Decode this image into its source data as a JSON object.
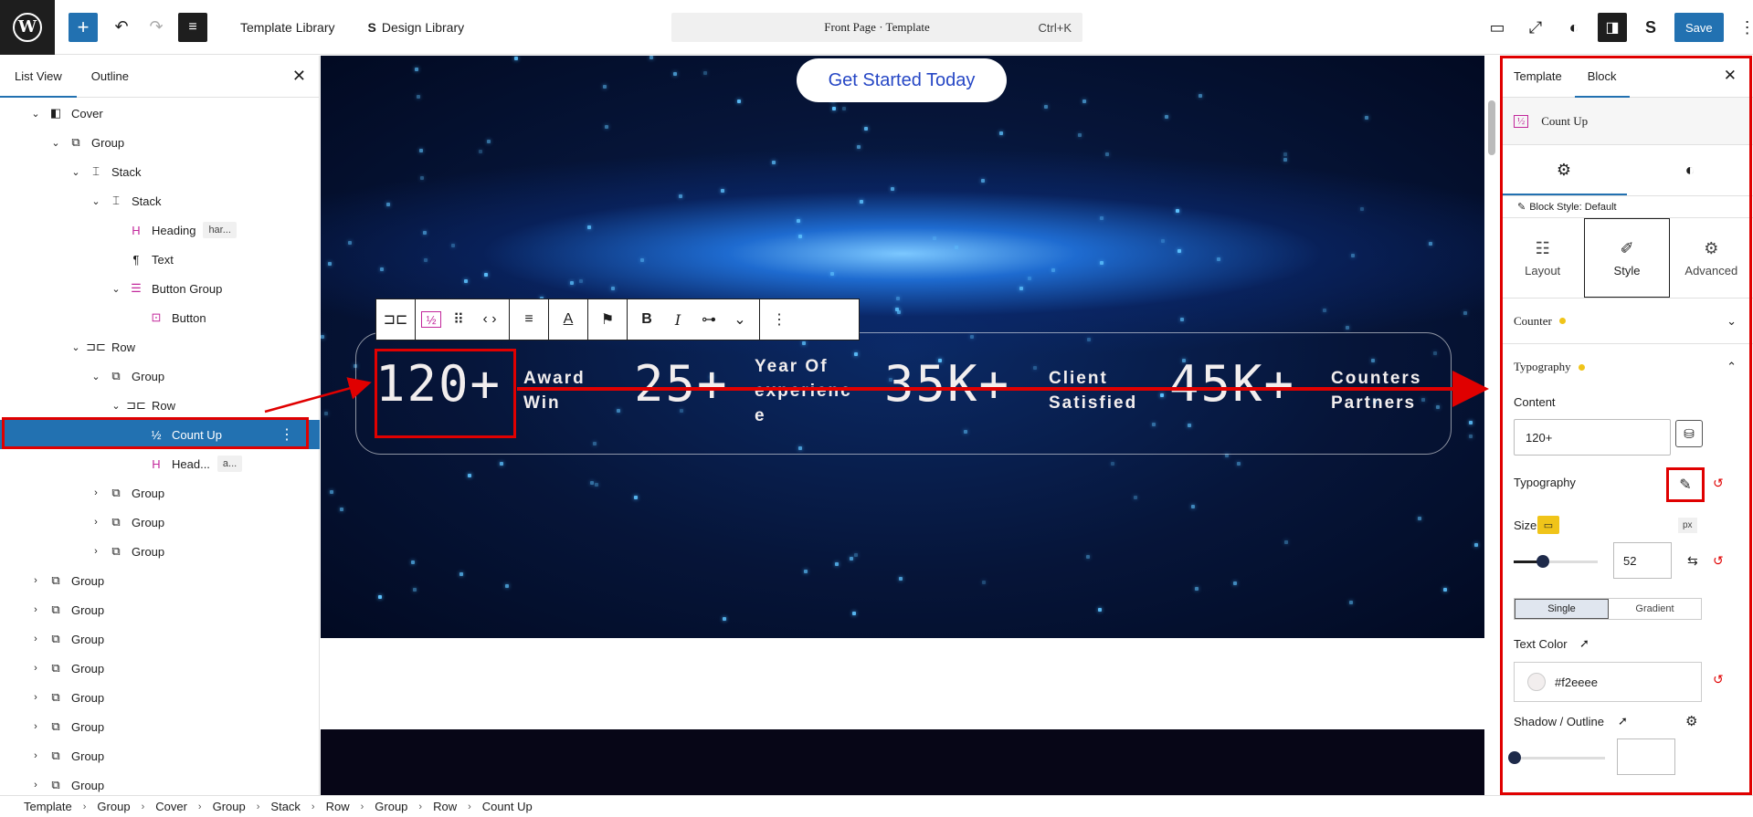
{
  "topbar": {
    "template_library": "Template Library",
    "design_library": "Design Library",
    "command_title": "Front Page · Template",
    "command_shortcut": "Ctrl+K",
    "save_label": "Save"
  },
  "left_panel": {
    "tabs": [
      "List View",
      "Outline"
    ],
    "tree": [
      {
        "label": "Cover",
        "icon": "cover-icon",
        "glyph": "◧",
        "depth": 0,
        "chevron": "⌄"
      },
      {
        "label": "Group",
        "icon": "group-icon",
        "glyph": "⧉",
        "depth": 1,
        "chevron": "⌄"
      },
      {
        "label": "Stack",
        "icon": "stack-icon",
        "glyph": "⌶",
        "depth": 2,
        "chevron": "⌄"
      },
      {
        "label": "Stack",
        "icon": "stack-icon",
        "glyph": "⌶",
        "depth": 3,
        "chevron": "⌄"
      },
      {
        "label": "Heading",
        "icon": "heading-icon",
        "glyph": "H",
        "depth": 4,
        "chevron": "",
        "badge": "har..."
      },
      {
        "label": "Text",
        "icon": "paragraph-icon",
        "glyph": "¶",
        "depth": 4,
        "chevron": ""
      },
      {
        "label": "Button Group",
        "icon": "button-group-icon",
        "glyph": "☰",
        "depth": 4,
        "chevron": "⌄"
      },
      {
        "label": "Button",
        "icon": "button-icon",
        "glyph": "⊡",
        "depth": 5,
        "chevron": ""
      },
      {
        "label": "Row",
        "icon": "row-icon",
        "glyph": "⊐⊏",
        "depth": 2,
        "chevron": "⌄"
      },
      {
        "label": "Group",
        "icon": "group-icon",
        "glyph": "⧉",
        "depth": 3,
        "chevron": "⌄"
      },
      {
        "label": "Row",
        "icon": "row-icon",
        "glyph": "⊐⊏",
        "depth": 4,
        "chevron": "⌄"
      },
      {
        "label": "Count Up",
        "icon": "count-up-icon",
        "glyph": "½",
        "depth": 5,
        "chevron": "",
        "selected": true
      },
      {
        "label": "Head...",
        "icon": "heading-icon",
        "glyph": "H",
        "depth": 5,
        "chevron": "",
        "badge": "a..."
      },
      {
        "label": "Group",
        "icon": "group-icon",
        "glyph": "⧉",
        "depth": 3,
        "chevron": "›"
      },
      {
        "label": "Group",
        "icon": "group-icon",
        "glyph": "⧉",
        "depth": 3,
        "chevron": "›"
      },
      {
        "label": "Group",
        "icon": "group-icon",
        "glyph": "⧉",
        "depth": 3,
        "chevron": "›"
      },
      {
        "label": "Group",
        "icon": "group-icon",
        "glyph": "⧉",
        "depth": 0,
        "chevron": "›"
      },
      {
        "label": "Group",
        "icon": "group-icon",
        "glyph": "⧉",
        "depth": 0,
        "chevron": "›"
      },
      {
        "label": "Group",
        "icon": "group-icon",
        "glyph": "⧉",
        "depth": 0,
        "chevron": "›"
      },
      {
        "label": "Group",
        "icon": "group-icon",
        "glyph": "⧉",
        "depth": 0,
        "chevron": "›"
      },
      {
        "label": "Group",
        "icon": "group-icon",
        "glyph": "⧉",
        "depth": 0,
        "chevron": "›"
      },
      {
        "label": "Group",
        "icon": "group-icon",
        "glyph": "⧉",
        "depth": 0,
        "chevron": "›"
      },
      {
        "label": "Group",
        "icon": "group-icon",
        "glyph": "⧉",
        "depth": 0,
        "chevron": "›"
      },
      {
        "label": "Group",
        "icon": "group-icon",
        "glyph": "⧉",
        "depth": 0,
        "chevron": "›"
      }
    ]
  },
  "canvas": {
    "cta_label": "Get Started Today",
    "counters": [
      {
        "number": "120+",
        "label_line1": "Award",
        "label_line2": "Win",
        "label_line3": ""
      },
      {
        "number": "25+",
        "label_line1": "Year Of",
        "label_line2": "experienc",
        "label_line3": "e"
      },
      {
        "number": "35K+",
        "label_line1": "Client",
        "label_line2": "Satisfied",
        "label_line3": ""
      },
      {
        "number": "45K+",
        "label_line1": "Counters",
        "label_line2": "Partners",
        "label_line3": ""
      }
    ],
    "counter_color": "#f2eeee"
  },
  "right_panel": {
    "tabs": [
      "Template",
      "Block"
    ],
    "block_name": "Count Up",
    "block_style": "Block Style: Default",
    "style_tabs": [
      "Layout",
      "Style",
      "Advanced"
    ],
    "sections": {
      "counter": "Counter",
      "typography": "Typography"
    },
    "content_label": "Content",
    "content_value": "120+",
    "typography_label": "Typography",
    "size_label": "Size",
    "size_unit": "px",
    "size_value": "52",
    "color_modes": [
      "Single",
      "Gradient"
    ],
    "text_color_label": "Text Color",
    "text_color_value": "#f2eeee",
    "shadow_label": "Shadow / Outline"
  },
  "breadcrumb": [
    "Template",
    "Group",
    "Cover",
    "Group",
    "Stack",
    "Row",
    "Group",
    "Row",
    "Count Up"
  ],
  "colors": {
    "accent": "#2271b1",
    "highlight": "#e00000",
    "dot": "#f0c419"
  }
}
